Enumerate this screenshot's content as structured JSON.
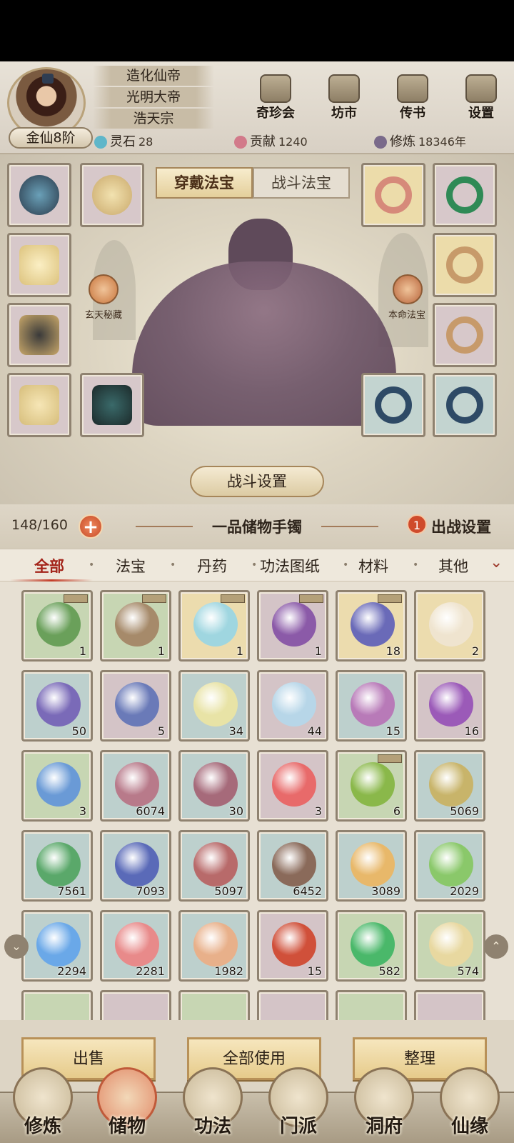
{
  "player": {
    "titles": [
      "造化仙帝",
      "光明大帝",
      "浩天宗"
    ],
    "rank": "金仙8阶"
  },
  "resources": [
    {
      "label": "灵石",
      "value": "28",
      "color": "#5fb6c9",
      "icon": "spirit-stone-icon"
    },
    {
      "label": "贡献",
      "value": "1240",
      "color": "#d27a8a",
      "icon": "contribution-icon"
    },
    {
      "label": "修炼",
      "value": "18346年",
      "color": "#7a6a8a",
      "icon": "cultivation-icon"
    }
  ],
  "top_buttons": [
    {
      "label": "奇珍会",
      "icon": "treasure-hall-icon"
    },
    {
      "label": "坊市",
      "icon": "market-icon"
    },
    {
      "label": "传书",
      "icon": "letter-icon"
    },
    {
      "label": "设置",
      "icon": "settings-gear-icon"
    }
  ],
  "equip": {
    "tabs": [
      "穿戴法宝",
      "战斗法宝"
    ],
    "active_tab": 0,
    "left_orb_label": "玄天秘藏",
    "right_orb_label": "本命法宝",
    "battle_settings": "战斗设置"
  },
  "bag": {
    "count": "148/160",
    "title": "一品储物手镯",
    "deploy_badge": "1",
    "deploy_label": "出战设置"
  },
  "categories": [
    "全部",
    "法宝",
    "丹药",
    "功法图纸",
    "材料",
    "其他"
  ],
  "items": [
    {
      "qty": "1",
      "tier": "green",
      "color": "#6aa05a",
      "lock": true
    },
    {
      "qty": "1",
      "tier": "green",
      "color": "#a68a6a",
      "lock": true
    },
    {
      "qty": "1",
      "tier": "gold",
      "color": "#9fd6e0",
      "lock": true
    },
    {
      "qty": "1",
      "tier": "purple",
      "color": "#8b5aa8",
      "lock": true
    },
    {
      "qty": "18",
      "tier": "gold",
      "color": "#6a6ab8",
      "lock": true
    },
    {
      "qty": "2",
      "tier": "gold",
      "color": "#efe4cf",
      "lock": false
    },
    {
      "qty": "50",
      "tier": "blue",
      "color": "#7a6ab8",
      "lock": false
    },
    {
      "qty": "5",
      "tier": "purple",
      "color": "#6a7ab8",
      "lock": false
    },
    {
      "qty": "34",
      "tier": "blue",
      "color": "#e8e3a6",
      "lock": false
    },
    {
      "qty": "44",
      "tier": "purple",
      "color": "#b7d6e8",
      "lock": false
    },
    {
      "qty": "15",
      "tier": "blue",
      "color": "#b87ab8",
      "lock": false
    },
    {
      "qty": "16",
      "tier": "purple",
      "color": "#9b5ab8",
      "lock": false
    },
    {
      "qty": "3",
      "tier": "green",
      "color": "#6a9ad6",
      "lock": false
    },
    {
      "qty": "6074",
      "tier": "blue",
      "color": "#b87a8a",
      "lock": false
    },
    {
      "qty": "30",
      "tier": "blue",
      "color": "#a66a7a",
      "lock": false
    },
    {
      "qty": "3",
      "tier": "purple",
      "color": "#e86a6a",
      "lock": false
    },
    {
      "qty": "6",
      "tier": "green",
      "color": "#8ab84a",
      "lock": true
    },
    {
      "qty": "5069",
      "tier": "blue",
      "color": "#c8b46a",
      "lock": false
    },
    {
      "qty": "7561",
      "tier": "blue",
      "color": "#5aa86a",
      "lock": false
    },
    {
      "qty": "7093",
      "tier": "blue",
      "color": "#5a6ab8",
      "lock": false
    },
    {
      "qty": "5097",
      "tier": "blue",
      "color": "#b86a6a",
      "lock": false
    },
    {
      "qty": "6452",
      "tier": "blue",
      "color": "#8a6a5a",
      "lock": false
    },
    {
      "qty": "3089",
      "tier": "blue",
      "color": "#e8b86a",
      "lock": false
    },
    {
      "qty": "2029",
      "tier": "blue",
      "color": "#8ac86a",
      "lock": false
    },
    {
      "qty": "2294",
      "tier": "blue",
      "color": "#6aa8e8",
      "lock": false
    },
    {
      "qty": "2281",
      "tier": "blue",
      "color": "#e88a8a",
      "lock": false
    },
    {
      "qty": "1982",
      "tier": "blue",
      "color": "#e8b08a",
      "lock": false
    },
    {
      "qty": "15",
      "tier": "purple",
      "color": "#d0503a",
      "lock": false
    },
    {
      "qty": "582",
      "tier": "green",
      "color": "#4ab86a",
      "lock": false
    },
    {
      "qty": "574",
      "tier": "green",
      "color": "#e8d8a0",
      "lock": false
    }
  ],
  "actions": [
    "出售",
    "全部使用",
    "整理"
  ],
  "nav": [
    {
      "label": "修炼",
      "icon": "cultivate-icon"
    },
    {
      "label": "储物",
      "icon": "storage-bag-icon"
    },
    {
      "label": "功法",
      "icon": "scroll-skill-icon"
    },
    {
      "label": "门派",
      "icon": "sect-gate-icon"
    },
    {
      "label": "洞府",
      "icon": "cave-mansion-icon"
    },
    {
      "label": "仙缘",
      "icon": "destiny-icon"
    }
  ],
  "nav_active": 1
}
